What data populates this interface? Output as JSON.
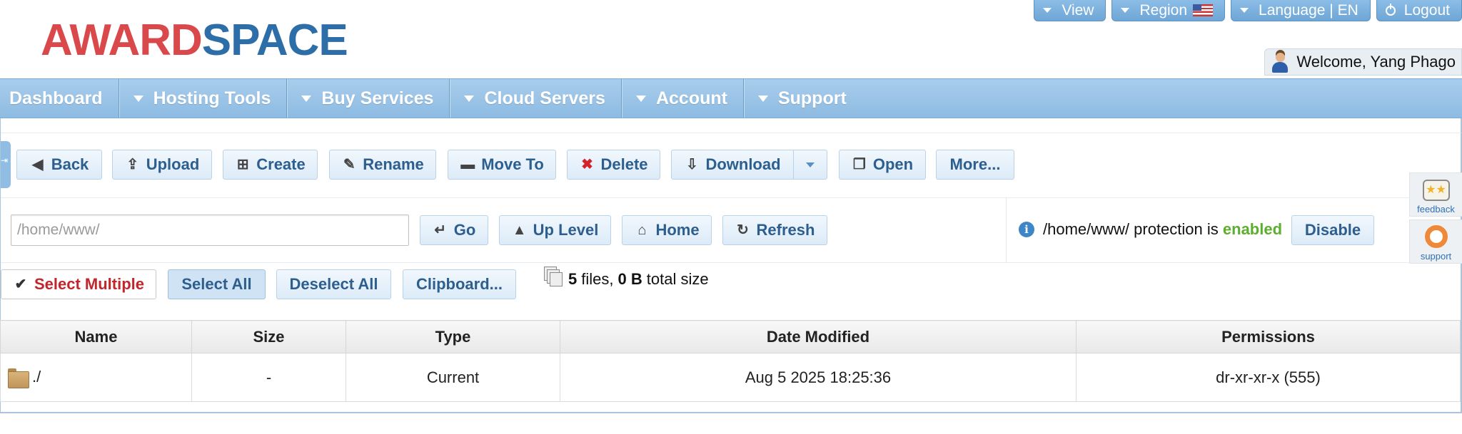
{
  "brand": {
    "logo_left": "AWARD",
    "logo_right": "SPACE"
  },
  "top_nav": [
    {
      "label": "View",
      "icon": "caret-down-icon"
    },
    {
      "label": "Region",
      "icon": "caret-down-icon",
      "extra": "us-flag-icon"
    },
    {
      "label": "Language | EN",
      "icon": "caret-down-icon"
    },
    {
      "label": "Logout",
      "icon": "power-icon"
    }
  ],
  "user": {
    "welcome": "Welcome, Yang Phago"
  },
  "main_nav": [
    {
      "label": "Dashboard",
      "dropdown": false
    },
    {
      "label": "Hosting Tools",
      "dropdown": true
    },
    {
      "label": "Buy Services",
      "dropdown": true
    },
    {
      "label": "Cloud Servers",
      "dropdown": true
    },
    {
      "label": "Account",
      "dropdown": true
    },
    {
      "label": "Support",
      "dropdown": true
    }
  ],
  "toolbar": {
    "back": "Back",
    "upload": "Upload",
    "create": "Create",
    "rename": "Rename",
    "move_to": "Move To",
    "delete": "Delete",
    "download": "Download",
    "open": "Open",
    "more": "More..."
  },
  "path_bar": {
    "value": "/home/www/",
    "go": "Go",
    "up_level": "Up Level",
    "home": "Home",
    "refresh": "Refresh"
  },
  "protection": {
    "text_before": "/home/www/ protection is",
    "status": "enabled",
    "status_color": "#5cae2e",
    "action": "Disable"
  },
  "selection": {
    "select_multiple": "Select Multiple",
    "select_all": "Select All",
    "deselect_all": "Deselect All",
    "clipboard": "Clipboard..."
  },
  "summary": {
    "file_count": "5",
    "files_label": "files,",
    "total_size": "0 B",
    "total_label": "total size"
  },
  "table": {
    "headers": [
      "Name",
      "Size",
      "Type",
      "Date Modified",
      "Permissions"
    ],
    "rows": [
      {
        "name": "./",
        "size": "-",
        "type": "Current",
        "modified": "Aug 5 2025 18:25:36",
        "permissions": "dr-xr-xr-x (555)"
      }
    ]
  },
  "widgets": {
    "feedback": "feedback",
    "support": "support"
  },
  "colors": {
    "brand_red": "#d9484b",
    "brand_blue": "#2e6ea8",
    "nav_blue": "#8dbbe2",
    "delete_red": "#d2232a"
  }
}
